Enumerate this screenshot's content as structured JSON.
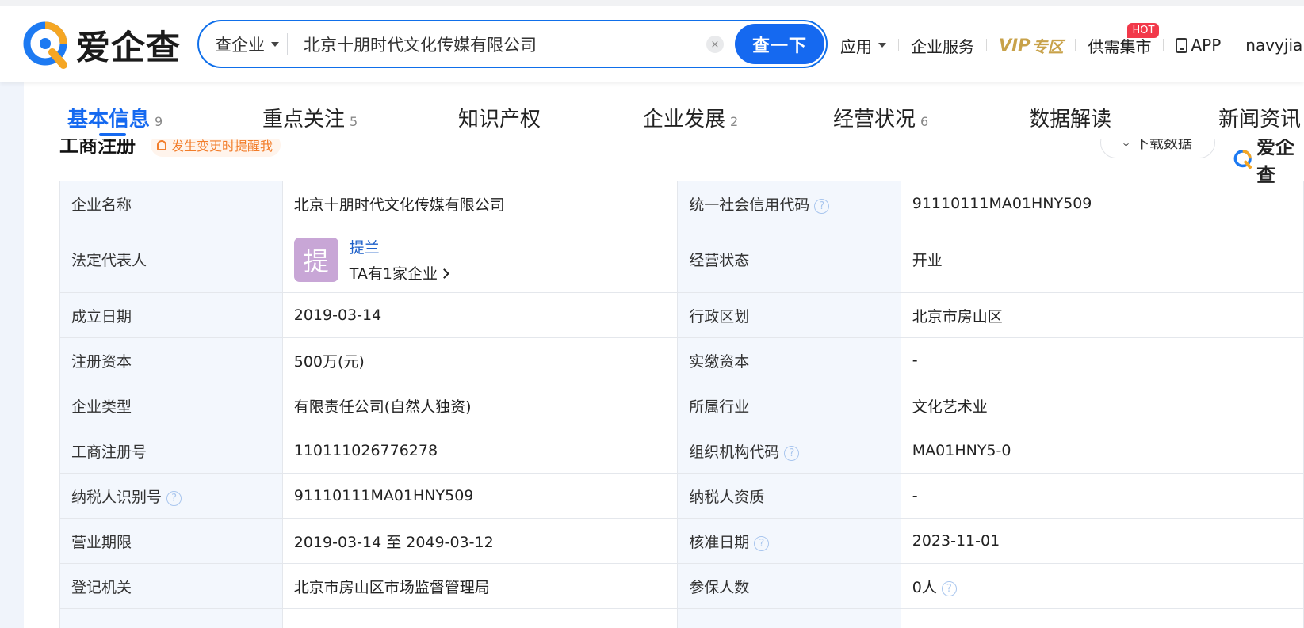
{
  "header": {
    "logo_text": "爱企查",
    "search": {
      "type_label": "查企业",
      "query": "北京十朋时代文化传媒有限公司",
      "clear_label": "×",
      "button_label": "查一下"
    },
    "nav": {
      "apps": "应用",
      "enterprise_service": "企业服务",
      "vip_prefix": "VIP",
      "vip_suffix": "专区",
      "market": "供需集市",
      "hot_badge": "HOT",
      "app": "APP",
      "user": "navyjiang"
    }
  },
  "tabs": [
    {
      "label": "基本信息",
      "count": "9"
    },
    {
      "label": "重点关注",
      "count": "5"
    },
    {
      "label": "知识产权",
      "count": ""
    },
    {
      "label": "企业发展",
      "count": "2"
    },
    {
      "label": "经营状况",
      "count": "6"
    },
    {
      "label": "数据解读",
      "count": ""
    },
    {
      "label": "新闻资讯",
      "count": ""
    }
  ],
  "section": {
    "title": "工商注册",
    "remind": "发生变更时提醒我",
    "download": "下载数据",
    "mini_logo": "爱企查"
  },
  "info": {
    "company_name_label": "企业名称",
    "company_name": "北京十朋时代文化传媒有限公司",
    "credit_code_label": "统一社会信用代码",
    "credit_code": "91110111MA01HNY509",
    "legal_rep_label": "法定代表人",
    "legal_rep_avatar": "提",
    "legal_rep_name": "提兰",
    "legal_rep_companies": "TA有1家企业",
    "status_label": "经营状态",
    "status": "开业",
    "found_date_label": "成立日期",
    "found_date": "2019-03-14",
    "region_label": "行政区划",
    "region": "北京市房山区",
    "reg_capital_label": "注册资本",
    "reg_capital": "500万(元)",
    "paid_capital_label": "实缴资本",
    "paid_capital": "-",
    "company_type_label": "企业类型",
    "company_type": "有限责任公司(自然人独资)",
    "industry_label": "所属行业",
    "industry": "文化艺术业",
    "reg_no_label": "工商注册号",
    "reg_no": "110111026776278",
    "org_code_label": "组织机构代码",
    "org_code": "MA01HNY5-0",
    "taxpayer_id_label": "纳税人识别号",
    "taxpayer_id": "91110111MA01HNY509",
    "taxpayer_qual_label": "纳税人资质",
    "taxpayer_qual": "-",
    "term_label": "营业期限",
    "term": "2019-03-14 至 2049-03-12",
    "approve_date_label": "核准日期",
    "approve_date": "2023-11-01",
    "authority_label": "登记机关",
    "authority": "北京市房山区市场监督管理局",
    "insured_label": "参保人数",
    "insured": "0人"
  },
  "colors": {
    "brand_blue": "#1569f0",
    "vip_gold": "#c8a24a",
    "hot_red": "#f2394a",
    "remind_orange": "#f27d2a",
    "label_bg": "#f3f7fd"
  },
  "icons": [
    "logo-icon",
    "caret-down-icon",
    "clear-icon",
    "phone-icon",
    "bell-icon",
    "download-icon",
    "question-icon",
    "chevron-right-icon"
  ]
}
